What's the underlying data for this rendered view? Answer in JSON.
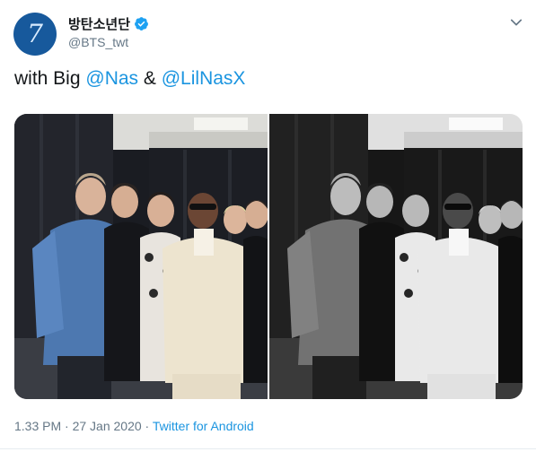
{
  "author": {
    "display_name": "방탄소년단",
    "handle": "@BTS_twt",
    "avatar_glyph": "7",
    "verified": true
  },
  "tweet": {
    "text_prefix": "with Big ",
    "mention_1": "@Nas",
    "joiner": " & ",
    "mention_2": "@LilNasX"
  },
  "media": {
    "photos": [
      {
        "tone": "color",
        "label": "group-photo-color"
      },
      {
        "tone": "grayscale",
        "label": "group-photo-bw"
      }
    ]
  },
  "meta": {
    "time": "1.33 PM",
    "separator": " · ",
    "date": "27 Jan 2020",
    "source": "Twitter for Android"
  },
  "colors": {
    "link": "#1b95e0",
    "secondary_text": "#657786",
    "verified": "#1da1f2",
    "avatar_bg": "#17599c"
  },
  "icons": {
    "verified": "verified-badge-icon",
    "more": "chevron-down-icon"
  }
}
